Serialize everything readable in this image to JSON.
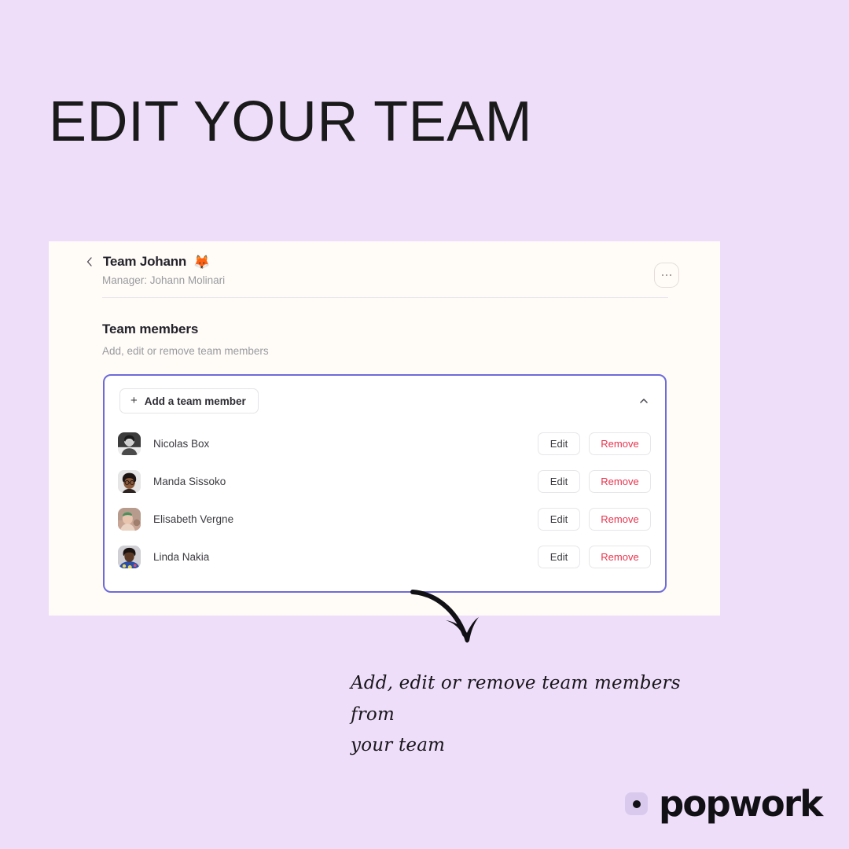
{
  "page": {
    "headline": "EDIT YOUR TEAM",
    "background_color": "#EEDEFA"
  },
  "card": {
    "background_color": "#FFFCF8",
    "header": {
      "back_icon": "chevron-left-icon",
      "team_name": "Team Johann",
      "team_emoji": "🦊",
      "manager_line": "Manager: Johann Molinari",
      "kebab_icon": "ellipsis-icon"
    },
    "section": {
      "title": "Team members",
      "subtitle": "Add, edit or remove team members"
    },
    "panel": {
      "border_color": "#6E6BD8",
      "add_button_label": "Add a team member",
      "add_button_icon": "plus-icon",
      "collapse_icon": "chevron-up-icon",
      "members": [
        {
          "name": "Nicolas Box",
          "avatar": "avatar-photo-bw-portrait",
          "edit_label": "Edit",
          "remove_label": "Remove"
        },
        {
          "name": "Manda Sissoko",
          "avatar": "avatar-illustration-glasses",
          "edit_label": "Edit",
          "remove_label": "Remove"
        },
        {
          "name": "Elisabeth Vergne",
          "avatar": "avatar-photo-headband",
          "edit_label": "Edit",
          "remove_label": "Remove"
        },
        {
          "name": "Linda Nakia",
          "avatar": "avatar-photo-floral-top",
          "edit_label": "Edit",
          "remove_label": "Remove"
        }
      ],
      "remove_color": "#E8344E"
    }
  },
  "annotation": {
    "arrow_icon": "curved-arrow-icon",
    "line1": "Add, edit or remove team members from",
    "line2": "your team"
  },
  "logo": {
    "mark_icon": "popwork-dot-icon",
    "text": "popwork"
  }
}
